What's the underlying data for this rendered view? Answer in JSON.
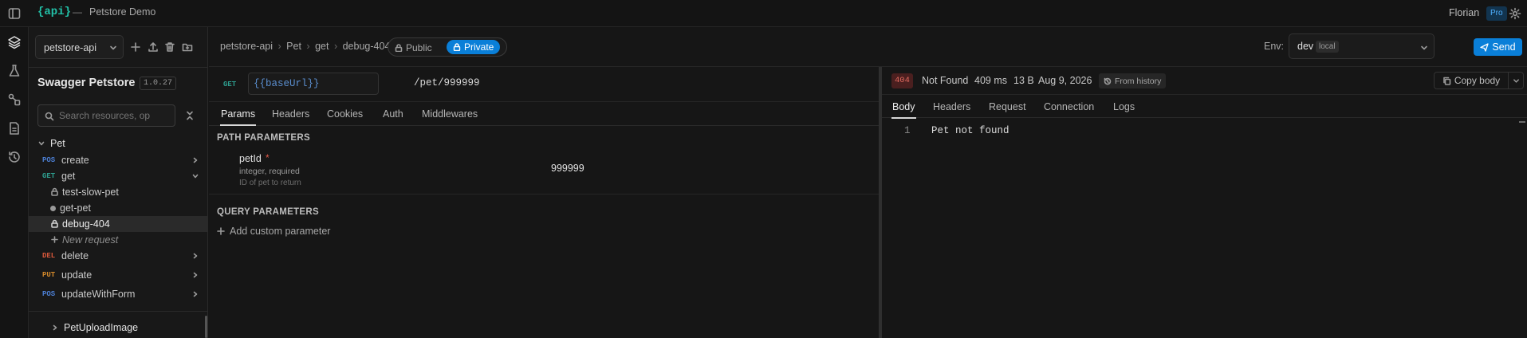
{
  "topbar": {
    "logo": "{api}",
    "separator": "—",
    "project_name": "Petstore Demo",
    "user_name": "Florian",
    "plan_badge": "Pro"
  },
  "sidebar": {
    "workspace": "petstore-api",
    "api_title": "Swagger Petstore",
    "api_version": "1.0.27",
    "search_placeholder": "Search resources, op",
    "tree": {
      "group": "Pet",
      "items": [
        {
          "method": "POS",
          "label": "create"
        },
        {
          "method": "GET",
          "label": "get"
        },
        {
          "label": "test-slow-pet"
        },
        {
          "label": "get-pet"
        },
        {
          "label": "debug-404"
        },
        {
          "label": "New request"
        },
        {
          "method": "DEL",
          "label": "delete"
        },
        {
          "method": "PUT",
          "label": "update"
        },
        {
          "method": "POS",
          "label": "updateWithForm"
        }
      ],
      "next_group": "PetUploadImage"
    }
  },
  "header": {
    "breadcrumb": [
      "petstore-api",
      "Pet",
      "get",
      "debug-404"
    ],
    "breadcrumb_sep": "›",
    "visibility": {
      "public_label": "Public",
      "private_label": "Private",
      "selected": "Private"
    },
    "env_label": "Env:",
    "env_name": "dev",
    "env_tag": "local",
    "send_label": "Send"
  },
  "request": {
    "method": "GET",
    "base_url": "{{baseUrl}}",
    "path": "/pet/999999",
    "tabs": [
      "Params",
      "Headers",
      "Cookies",
      "Auth",
      "Middlewares"
    ],
    "active_tab": "Params",
    "path_params_title": "PATH PARAMETERS",
    "param": {
      "name": "petId",
      "required_mark": "*",
      "type": "integer, required",
      "description": "ID of pet to return",
      "value": "999999"
    },
    "query_params_title": "QUERY PARAMETERS",
    "add_param_label": "Add custom parameter"
  },
  "response": {
    "status_code": "404",
    "status_text": "Not Found",
    "time": "409 ms",
    "size": "13 B",
    "date": "Aug 9, 2026",
    "history_label": "From history",
    "copy_label": "Copy body",
    "tabs": [
      "Body",
      "Headers",
      "Request",
      "Connection",
      "Logs"
    ],
    "active_tab": "Body",
    "body_lines": [
      {
        "num": "1",
        "text": "Pet not found"
      }
    ]
  },
  "colors": {
    "accent": "#0a7fd8",
    "get": "#2e9e8f",
    "post": "#4c7fd4",
    "delete": "#d9583b",
    "put": "#d58a2b",
    "error_badge_bg": "#4a1f1f",
    "error_badge_fg": "#e26a5f",
    "logo": "#22c1a8"
  }
}
